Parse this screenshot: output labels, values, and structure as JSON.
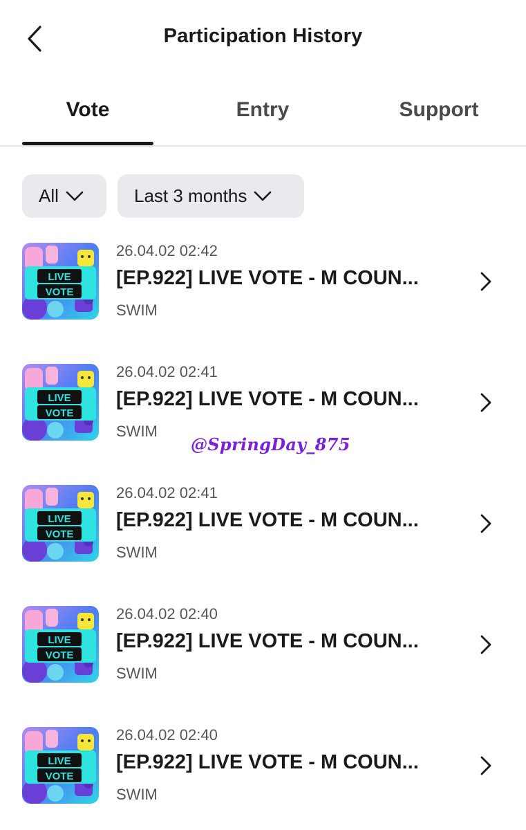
{
  "header": {
    "title": "Participation History",
    "back_icon": "chevron-left-icon"
  },
  "tabs": [
    {
      "label": "Vote",
      "active": true
    },
    {
      "label": "Entry",
      "active": false
    },
    {
      "label": "Support",
      "active": false
    }
  ],
  "filters": {
    "type": "All",
    "period": "Last 3 months",
    "dropdown_icon": "chevron-down-icon"
  },
  "items": [
    {
      "date": "26.04.02 02:42",
      "title": "[EP.922] LIVE VOTE - M COUN...",
      "subtitle": "SWIM",
      "thumb_line1": "LIVE",
      "thumb_line2": "VOTE"
    },
    {
      "date": "26.04.02 02:41",
      "title": "[EP.922] LIVE VOTE - M COUN...",
      "subtitle": "SWIM",
      "thumb_line1": "LIVE",
      "thumb_line2": "VOTE"
    },
    {
      "date": "26.04.02 02:41",
      "title": "[EP.922] LIVE VOTE - M COUN...",
      "subtitle": "SWIM",
      "thumb_line1": "LIVE",
      "thumb_line2": "VOTE"
    },
    {
      "date": "26.04.02 02:40",
      "title": "[EP.922] LIVE VOTE - M COUN...",
      "subtitle": "SWIM",
      "thumb_line1": "LIVE",
      "thumb_line2": "VOTE"
    },
    {
      "date": "26.04.02 02:40",
      "title": "[EP.922] LIVE VOTE - M COUN...",
      "subtitle": "SWIM",
      "thumb_line1": "LIVE",
      "thumb_line2": "VOTE"
    }
  ],
  "watermark": "@SpringDay_875",
  "colors": {
    "text": "#1a1a1a",
    "secondary_text": "#555558",
    "chip_bg": "#e9eaee",
    "divider": "#e6e6e8",
    "watermark": "#7a22d6",
    "thumb_cyan": "#2fd6e8",
    "thumb_pink": "#f7a8d8",
    "thumb_purple": "#6a3fd8",
    "thumb_yellow": "#f5e63a"
  }
}
